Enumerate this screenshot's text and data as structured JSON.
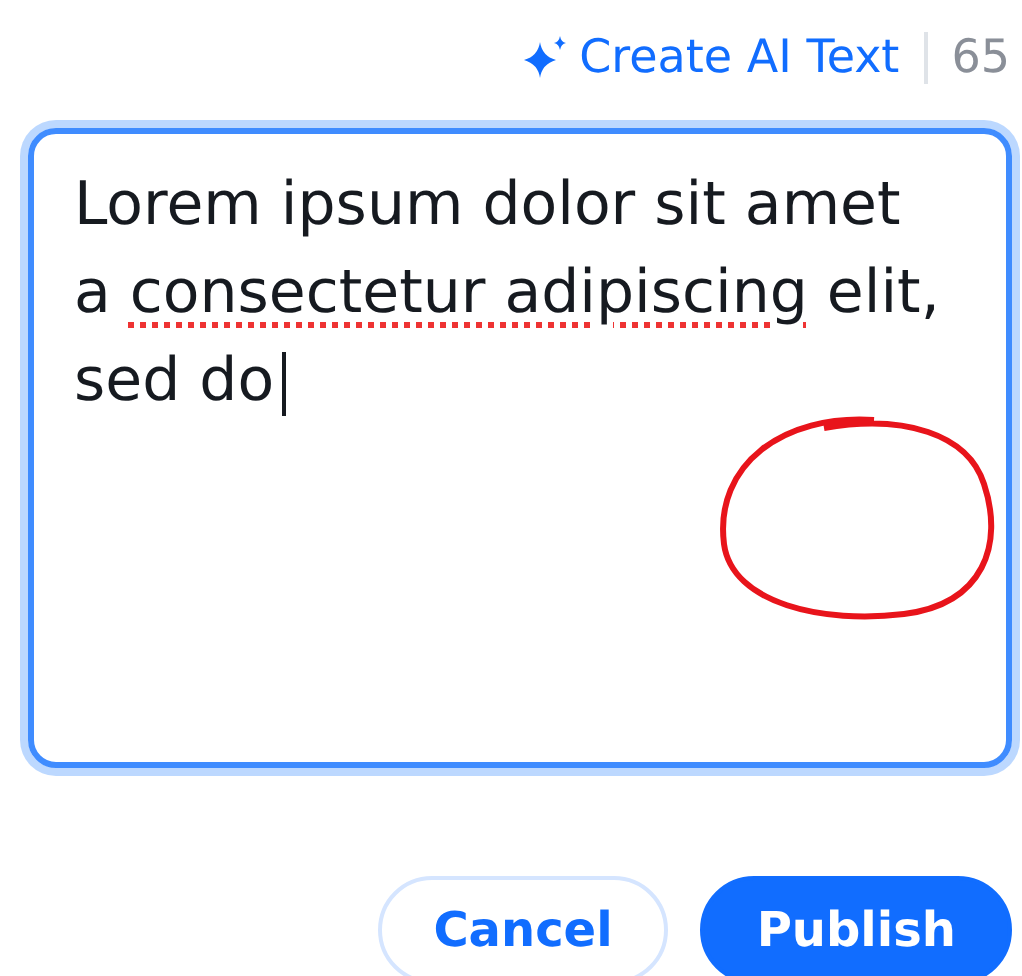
{
  "ai_link": {
    "label": "Create AI Text"
  },
  "counter": "65",
  "editor": {
    "lines": [
      [
        {
          "text": "Lorem ipsum dolor sit amet",
          "misspelled": false
        }
      ],
      [
        {
          "text": "a ",
          "misspelled": false
        },
        {
          "text": "consectetur adipiscing",
          "misspelled": true
        },
        {
          "text": " elit,",
          "misspelled": false
        }
      ],
      [
        {
          "text": "sed do",
          "misspelled": false
        }
      ]
    ],
    "caret": true
  },
  "buttons": [
    {
      "label": "Cancel",
      "kind": "secondary"
    },
    {
      "label": "Publish",
      "kind": "primary"
    }
  ]
}
